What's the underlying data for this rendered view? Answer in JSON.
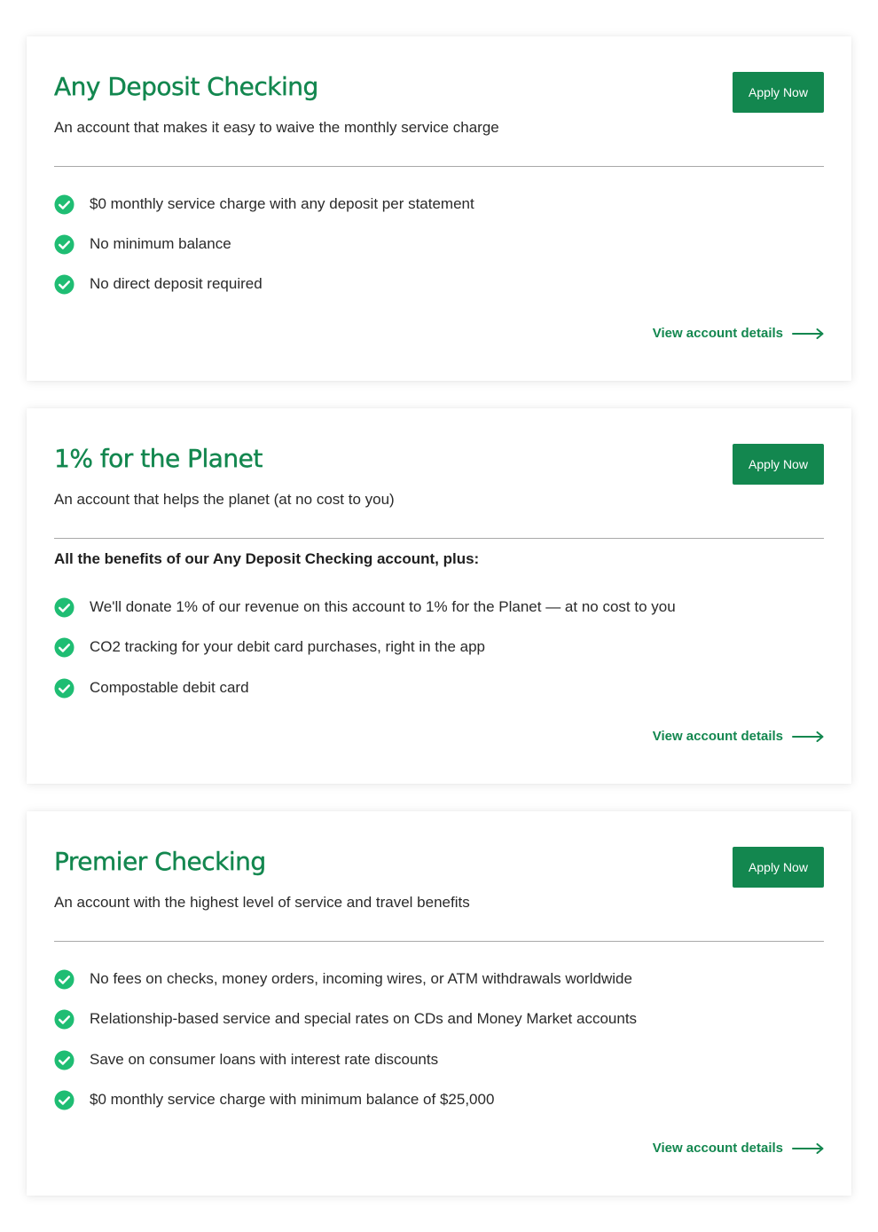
{
  "colors": {
    "brand": "#13874f",
    "check": "#1fbd73",
    "divider": "#a9a9a9"
  },
  "cards": [
    {
      "title": "Any Deposit Checking",
      "subtitle": "An account that makes it easy to waive the monthly service charge",
      "apply_label": "Apply Now",
      "features": [
        "$0 monthly service charge with any deposit per statement",
        "No minimum balance",
        "No direct deposit required"
      ],
      "details_label": "View account details",
      "icons": {
        "check": "check-circle-icon",
        "arrow": "arrow-right-icon"
      }
    },
    {
      "title": "1% for the Planet",
      "subtitle": "An account that helps the planet (at no cost to you)",
      "apply_label": "Apply Now",
      "plus_label": "All the benefits of our Any Deposit Checking account, plus:",
      "features": [
        "We'll donate 1% of our revenue on this account to 1% for the Planet — at no cost to you",
        "CO2 tracking for your debit card purchases, right in the app",
        "Compostable debit card"
      ],
      "details_label": "View account details",
      "icons": {
        "check": "check-circle-icon",
        "arrow": "arrow-right-icon"
      }
    },
    {
      "title": "Premier Checking",
      "subtitle": "An account with the highest level of service and travel benefits",
      "apply_label": "Apply Now",
      "features": [
        "No fees on checks, money orders, incoming wires, or ATM withdrawals worldwide",
        "Relationship-based service and special rates on CDs and Money Market accounts",
        "Save on consumer loans with interest rate discounts",
        "$0 monthly service charge with minimum balance of $25,000"
      ],
      "details_label": "View account details",
      "icons": {
        "check": "check-circle-icon",
        "arrow": "arrow-right-icon"
      }
    }
  ]
}
